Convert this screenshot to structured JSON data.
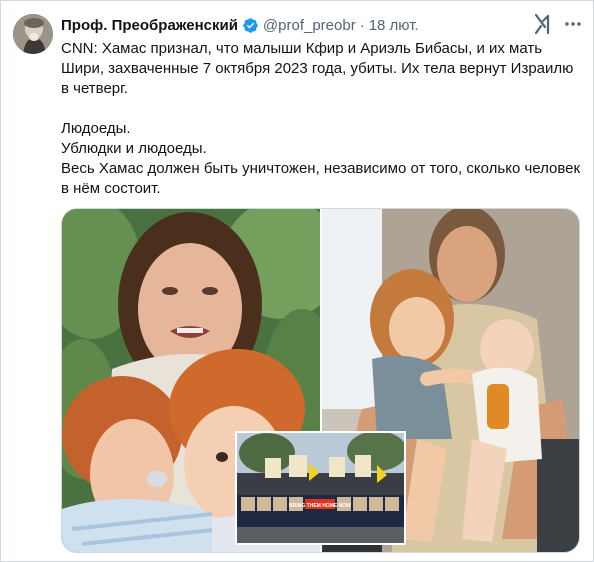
{
  "tweet": {
    "author_name": "Проф. Преображенский",
    "handle": "@prof_preobr",
    "separator": "·",
    "time": "18 лют.",
    "paragraphs": [
      "CNN: Хамас признал, что малыши Кфир и Ариэль Бибасы, и их мать Шири, захваченные 7 октября 2023 года, убиты. Их тела вернут Израилю в четверг."
    ],
    "lines": [
      "Людоеды.",
      "Ублюдки и людоеды.",
      "Весь Хамас должен быть уничтожен, независимо от того, сколько человек в нём состоит."
    ],
    "banner_text": "BRING THEM HOME NOW"
  },
  "icons": {
    "verified": "verified-badge-icon",
    "grok": "grok-icon",
    "more": "more-options-icon"
  },
  "colors": {
    "verified_blue": "#1d9bf0",
    "text_primary": "#0f1419",
    "text_secondary": "#536471",
    "border": "#cfd9de"
  }
}
